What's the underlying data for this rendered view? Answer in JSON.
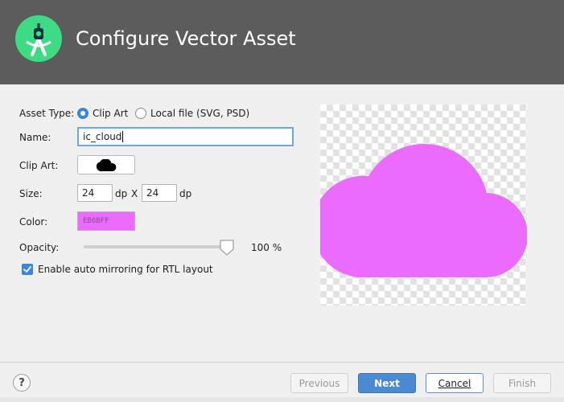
{
  "header": {
    "title": "Configure Vector Asset",
    "logo_icon": "android-studio-icon",
    "background": "#5c5c5c"
  },
  "form": {
    "asset_type": {
      "label": "Asset Type:",
      "options": [
        "Clip Art",
        "Local file (SVG, PSD)"
      ],
      "selected": "Clip Art"
    },
    "name": {
      "label": "Name:",
      "value": "ic_cloud"
    },
    "clip_art": {
      "label": "Clip Art:",
      "icon": "cloud-icon"
    },
    "size": {
      "label": "Size:",
      "width": "24",
      "height": "24",
      "unit": "dp",
      "separator": "X"
    },
    "color": {
      "label": "Color:",
      "value": "EB6BFF",
      "hex": "#EB6BFF"
    },
    "opacity": {
      "label": "Opacity:",
      "value": 100,
      "display": "100 %"
    },
    "auto_mirror": {
      "label": "Enable auto mirroring for RTL layout",
      "checked": true
    }
  },
  "preview": {
    "icon": "cloud-icon",
    "color": "#EB6BFF"
  },
  "footer": {
    "help_label": "?",
    "previous_label": "Previous",
    "next_label": "Next",
    "cancel_label": "Cancel",
    "finish_label": "Finish"
  }
}
